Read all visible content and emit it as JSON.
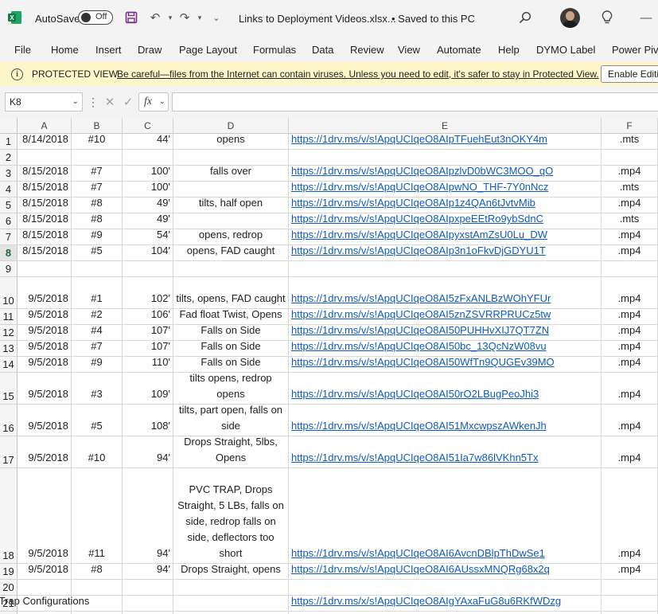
{
  "titlebar": {
    "autosave_label": "AutoSave",
    "autosave_state": "Off",
    "doc_title": "Links to Deployment Videos.xlsx...",
    "saved_status": "• Saved to this PC"
  },
  "menu": [
    "File",
    "Home",
    "Insert",
    "Draw",
    "Page Layout",
    "Formulas",
    "Data",
    "Review",
    "View",
    "Automate",
    "Help",
    "DYMO Label",
    "Power Pivot"
  ],
  "protected_view": {
    "title": "PROTECTED VIEW",
    "message": "Be careful—files from the Internet can contain viruses. Unless you need to edit, it's safer to stay in Protected View.",
    "button": "Enable Editing"
  },
  "formula_bar": {
    "name_box": "K8",
    "fx": "fx",
    "formula": ""
  },
  "sheet": {
    "columns": [
      "A",
      "B",
      "C",
      "D",
      "E",
      "F"
    ],
    "selected_row": "8",
    "rows": [
      {
        "n": "1",
        "a": "8/14/2018",
        "b": "#10",
        "c": "44'",
        "d": "opens",
        "e": "https://1drv.ms/v/s!ApqUCIqeO8AIpTFuehEut3nOKY4m",
        "f": ".mts"
      },
      {
        "n": "2",
        "a": "",
        "b": "",
        "c": "",
        "d": "",
        "e": "",
        "f": ""
      },
      {
        "n": "3",
        "a": "8/15/2018",
        "b": "#7",
        "c": "100'",
        "d": "falls over",
        "e": "https://1drv.ms/v/s!ApqUCIqeO8AIpzlvD0bWC3MOO_qO",
        "f": ".mp4"
      },
      {
        "n": "4",
        "a": "8/15/2018",
        "b": "#7",
        "c": "100'",
        "d": "",
        "e": "https://1drv.ms/v/s!ApqUCIqeO8AIpwNO_THF-7Y0nNcz",
        "f": ".mts"
      },
      {
        "n": "5",
        "a": "8/15/2018",
        "b": "#8",
        "c": "49'",
        "d": "tilts, half open",
        "e": "https://1drv.ms/v/s!ApqUCIqeO8AIp1z4QAn6tJvtvMib",
        "f": ".mp4"
      },
      {
        "n": "6",
        "a": "8/15/2018",
        "b": "#8",
        "c": "49'",
        "d": "",
        "e": "https://1drv.ms/v/s!ApqUCIqeO8AIpxpeEEtRo9ybSdnC",
        "f": ".mts"
      },
      {
        "n": "7",
        "a": "8/15/2018",
        "b": "#9",
        "c": "54'",
        "d": "opens, redrop",
        "e": "https://1drv.ms/v/s!ApqUCIqeO8AIpyxstAmZsU0Lu_DW",
        "f": ".mp4"
      },
      {
        "n": "8",
        "a": "8/15/2018",
        "b": "#5",
        "c": "104'",
        "d": "opens, FAD caught",
        "e": "https://1drv.ms/v/s!ApqUCIqeO8AIp3n1oFkvDjGDYU1T",
        "f": ".mp4"
      },
      {
        "n": "9",
        "a": "",
        "b": "",
        "c": "",
        "d": "",
        "e": "",
        "f": ""
      },
      {
        "n": "10",
        "a": "9/5/2018",
        "b": "#1",
        "c": "102'",
        "d": "tilts, opens, FAD caught",
        "e": "https://1drv.ms/v/s!ApqUCIqeO8AI5zFxANLBzWOhYFUr",
        "f": ".mp4"
      },
      {
        "n": "11",
        "a": "9/5/2018",
        "b": "#2",
        "c": "106'",
        "d": "Fad float Twist, Opens",
        "e": "https://1drv.ms/v/s!ApqUCIqeO8AI5znZSVRRPRUCz5tw",
        "f": ".mp4"
      },
      {
        "n": "12",
        "a": "9/5/2018",
        "b": "#4",
        "c": "107'",
        "d": "Falls on Side",
        "e": "https://1drv.ms/v/s!ApqUCIqeO8AI50PUHHvXIJ7QT7ZN",
        "f": ".mp4"
      },
      {
        "n": "13",
        "a": "9/5/2018",
        "b": "#7",
        "c": "107'",
        "d": "Falls on Side",
        "e": "https://1drv.ms/v/s!ApqUCIqeO8AI50bc_13QcNzW08vu",
        "f": ".mp4"
      },
      {
        "n": "14",
        "a": "9/5/2018",
        "b": "#9",
        "c": "110'",
        "d": "Falls on Side",
        "e": "https://1drv.ms/v/s!ApqUCIqeO8AI50WfTn9QUGEv39MO",
        "f": ".mp4"
      },
      {
        "n": "15",
        "a": "9/5/2018",
        "b": "#3",
        "c": "109'",
        "d": "tilts opens, redrop opens",
        "e": "https://1drv.ms/v/s!ApqUCIqeO8AI50rO2LBugPeoJhi3",
        "f": ".mp4"
      },
      {
        "n": "16",
        "a": "9/5/2018",
        "b": "#5",
        "c": "108'",
        "d": "tilts, part open, falls on side",
        "e": "https://1drv.ms/v/s!ApqUCIqeO8AI51MxcwpszAWkenJh",
        "f": ".mp4"
      },
      {
        "n": "17",
        "a": "9/5/2018",
        "b": "#10",
        "c": "94'",
        "d": "Drops Straight, 5lbs, Opens",
        "e": "https://1drv.ms/v/s!ApqUCIqeO8AI51Ia7w86lVKhn5Tx",
        "f": ".mp4"
      },
      {
        "n": "18",
        "a": "9/5/2018",
        "b": "#11",
        "c": "94'",
        "d": "PVC TRAP, Drops Straight, 5 LBs, falls on side, redrop falls on side, deflectors too short",
        "e": "https://1drv.ms/v/s!ApqUCIqeO8AI6AvcnDBlpThDwSe1",
        "f": ".mp4"
      },
      {
        "n": "19",
        "a": "9/5/2018",
        "b": "#8",
        "c": "94'",
        "d": "Drops Straight, opens",
        "e": "https://1drv.ms/v/s!ApqUCIqeO8AI6AUssxMNQRg68x2q",
        "f": ".mp4"
      },
      {
        "n": "20",
        "a": "",
        "b": "",
        "c": "",
        "d": "",
        "e": "",
        "f": ""
      },
      {
        "n": "21",
        "a": "Trap Configurations",
        "b": "",
        "c": "",
        "d": "",
        "e": "https://1drv.ms/x/s!ApqUCIqeO8AIgYAxaFuG8u6RKfWDzg",
        "f": ""
      },
      {
        "n": "22",
        "a": "",
        "b": "",
        "c": "",
        "d": "",
        "e": "",
        "f": ""
      }
    ]
  }
}
